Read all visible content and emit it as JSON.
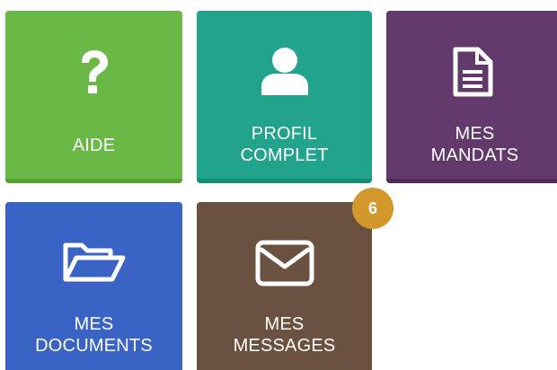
{
  "tiles": {
    "aide": {
      "line1": "AIDE",
      "icon": "question-icon",
      "color": "#6ab845"
    },
    "profil": {
      "line1": "PROFIL",
      "line2": "COMPLET",
      "icon": "user-icon",
      "color": "#22a48c"
    },
    "mandats": {
      "line1": "MES",
      "line2": "MANDATS",
      "icon": "document-icon",
      "color": "#613a6b"
    },
    "documents": {
      "line1": "MES",
      "line2": "DOCUMENTS",
      "icon": "folder-open-icon",
      "color": "#3a63c6"
    },
    "messages": {
      "line1": "MES",
      "line2": "MESSAGES",
      "icon": "envelope-icon",
      "color": "#6a5140",
      "badge": "6",
      "badge_color": "#d3982b"
    }
  }
}
